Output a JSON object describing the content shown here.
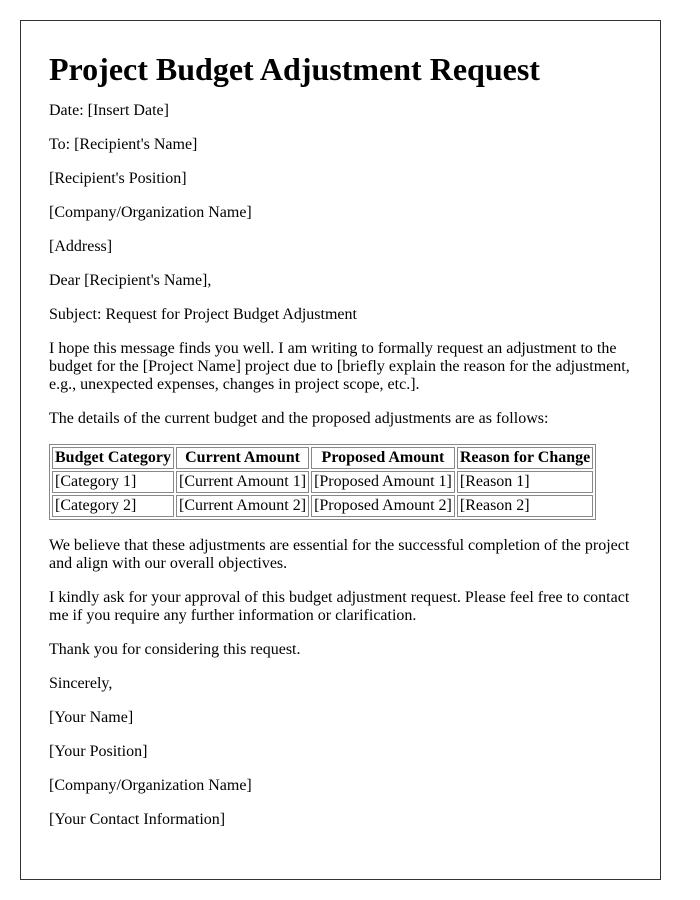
{
  "title": "Project Budget Adjustment Request",
  "header_lines": [
    "Date: [Insert Date]",
    "To: [Recipient's Name]",
    "[Recipient's Position]",
    "[Company/Organization Name]",
    "[Address]"
  ],
  "salutation": "Dear [Recipient's Name],",
  "subject": "Subject: Request for Project Budget Adjustment",
  "body_intro": "I hope this message finds you well. I am writing to formally request an adjustment to the budget for the [Project Name] project due to [briefly explain the reason for the adjustment, e.g., unexpected expenses, changes in project scope, etc.].",
  "table_intro": "The details of the current budget and the proposed adjustments are as follows:",
  "table": {
    "headers": [
      "Budget Category",
      "Current Amount",
      "Proposed Amount",
      "Reason for Change"
    ],
    "rows": [
      [
        "[Category 1]",
        "[Current Amount 1]",
        "[Proposed Amount 1]",
        "[Reason 1]"
      ],
      [
        "[Category 2]",
        "[Current Amount 2]",
        "[Proposed Amount 2]",
        "[Reason 2]"
      ]
    ]
  },
  "body_paragraphs": [
    "We believe that these adjustments are essential for the successful completion of the project and align with our overall objectives.",
    "I kindly ask for your approval of this budget adjustment request. Please feel free to contact me if you require any further information or clarification.",
    "Thank you for considering this request."
  ],
  "closing": "Sincerely,",
  "signature_lines": [
    "[Your Name]",
    "[Your Position]",
    "[Company/Organization Name]",
    "[Your Contact Information]"
  ]
}
